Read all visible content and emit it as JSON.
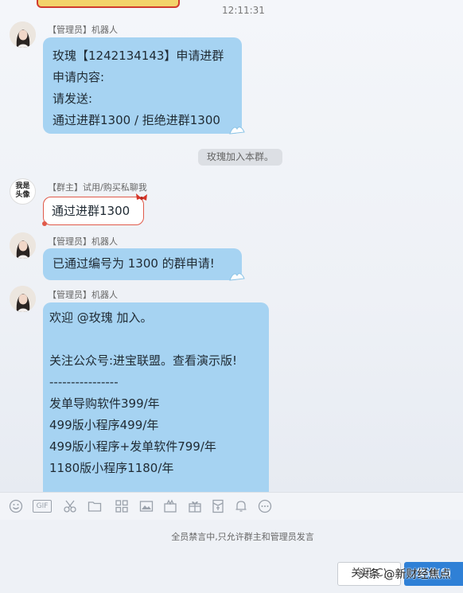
{
  "chat": {
    "timestamp": "12:11:31",
    "messages": [
      {
        "role_badge": "【管理员】",
        "sender": "机器人",
        "lines": [
          "玫瑰【1242134143】申请进群",
          "申请内容:",
          "请发送:",
          "通过进群1300 / 拒绝进群1300"
        ]
      },
      {
        "role_badge": "【群主】",
        "sender": "试用/购买私聊我",
        "lines": [
          "通过进群1300"
        ]
      },
      {
        "role_badge": "【管理员】",
        "sender": "机器人",
        "lines": [
          "已通过编号为 1300 的群申请!"
        ]
      },
      {
        "role_badge": "【管理员】",
        "sender": "机器人",
        "lines": [
          "欢迎 @玫瑰  加入。",
          "",
          "关注公众号:进宝联盟。查看演示版!",
          "----------------",
          "发单导购软件399/年",
          "499版小程序499/年",
          "499版小程序+发单软件799/年",
          "1180版小程序1180/年"
        ]
      }
    ],
    "system_notice": "玫瑰加入本群。",
    "owner_avatar_text": "我是头像"
  },
  "toolbar": {
    "icons": [
      "emoji-icon",
      "gif-icon",
      "scissors-icon",
      "folder-icon",
      "app-grid-icon",
      "image-icon",
      "gift-box-icon",
      "present-icon",
      "red-envelope-icon",
      "bell-icon",
      "more-icon"
    ],
    "gif_label": "GIF"
  },
  "composer": {
    "mute_notice": "全员禁言中,只允许群主和管理员发言",
    "close_label": "关闭(C)",
    "send_label": "发送(S)"
  },
  "watermark": "头条 @新财经焦点",
  "colors": {
    "bubble": "#a6d3f2",
    "send_button": "#2f80d6",
    "owner_bubble_border": "#e05a4a"
  }
}
